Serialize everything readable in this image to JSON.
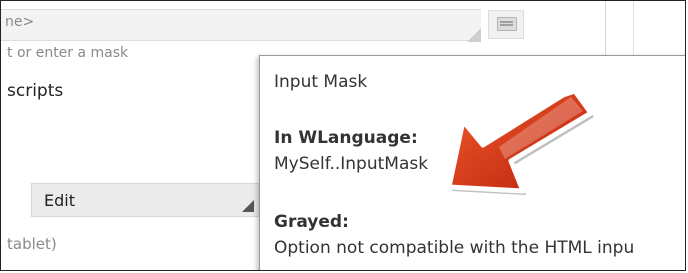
{
  "top_field": {
    "text": "ne>"
  },
  "hint": {
    "text": "t or enter a mask"
  },
  "scripts": {
    "text": "scripts"
  },
  "edit_combo": {
    "label": "Edit"
  },
  "tablet": {
    "text": "tablet)"
  },
  "tooltip": {
    "title": "Input Mask",
    "wlanguage_label": "In WLanguage:",
    "wlanguage_value": "MySelf..InputMask",
    "grayed_label": "Grayed:",
    "grayed_value": "Option not compatible with the HTML inpu"
  },
  "icons": {
    "arrow": "pointer-arrow-icon",
    "flag": "card-icon",
    "combo": "dropdown-arrow-icon"
  },
  "colors": {
    "arrow_fill": "#d93616",
    "arrow_outline": "#ffffff"
  }
}
